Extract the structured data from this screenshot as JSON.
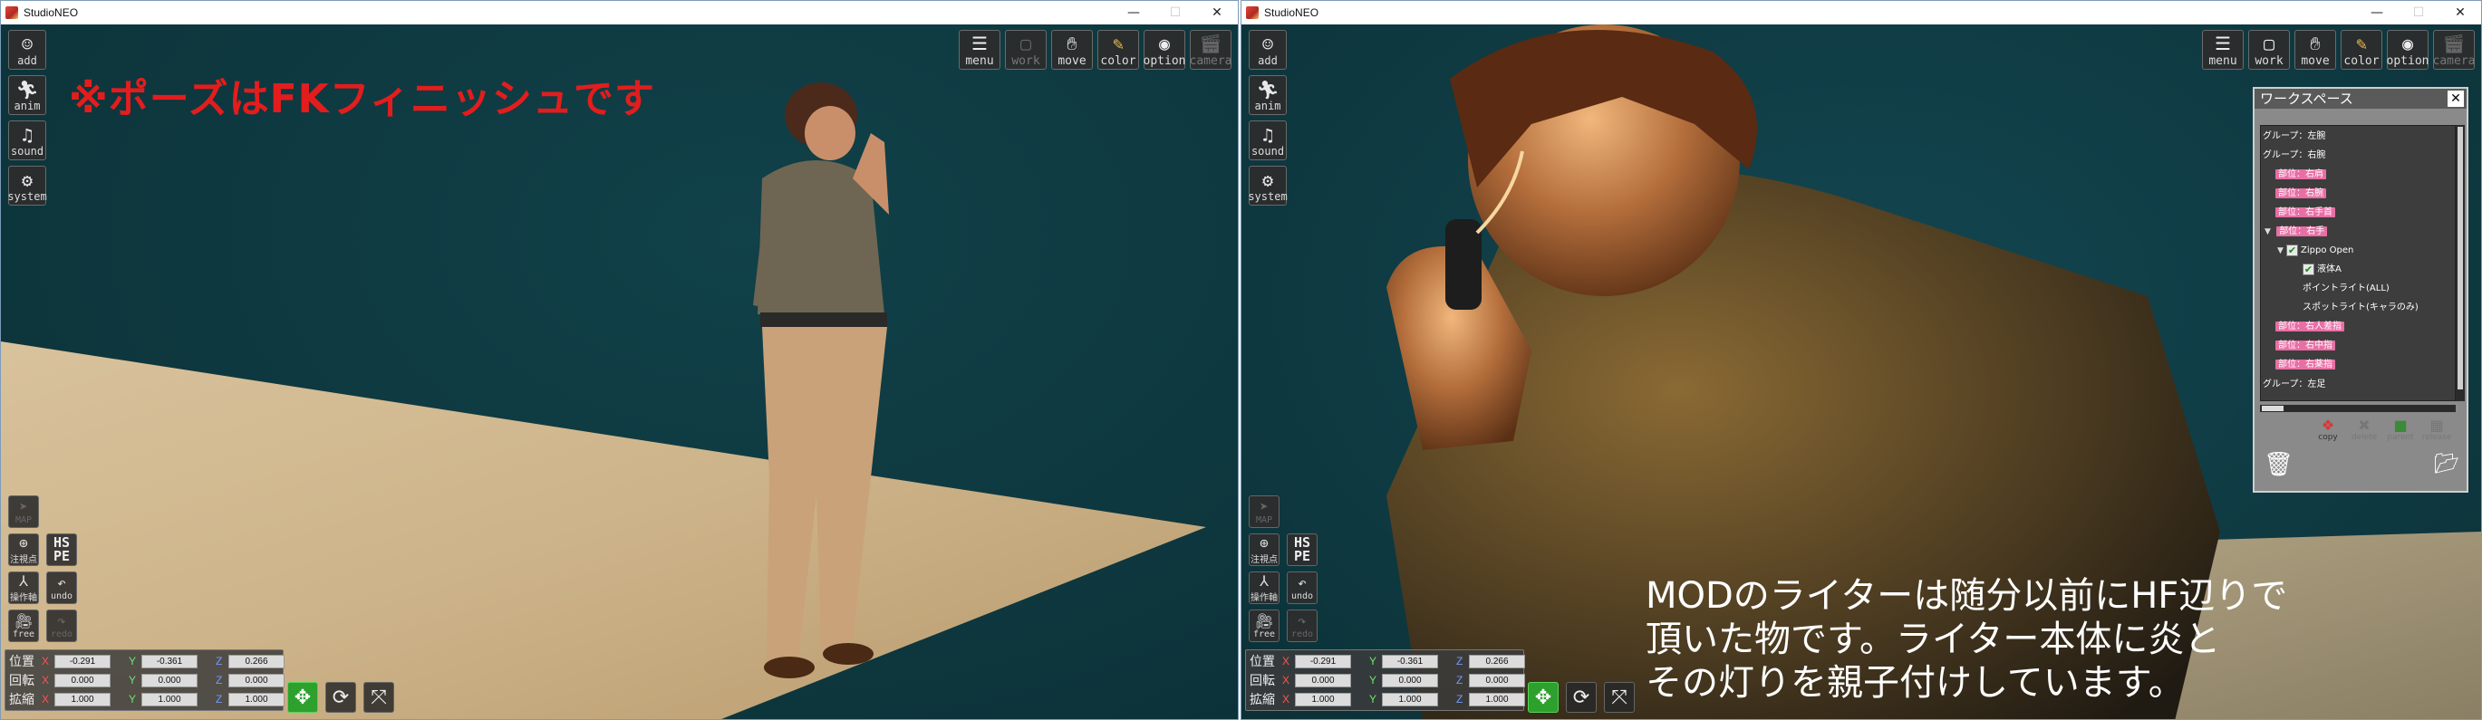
{
  "windows": [
    {
      "title": "StudioNEO",
      "overlay_text": "※ポーズはFKフィニッシュです"
    },
    {
      "title": "StudioNEO",
      "caption": "MODのライターは随分以前にHF辺りで\n頂いた物です。ライター本体に炎と\nその灯りを親子付けしています。"
    }
  ],
  "window_controls": {
    "minimize": "—",
    "maximize": "☐",
    "close": "✕"
  },
  "left_toolbar": [
    {
      "label": "add",
      "icon": "add-character-icon"
    },
    {
      "label": "anim",
      "icon": "running-figure-icon"
    },
    {
      "label": "sound",
      "icon": "music-note-icon"
    },
    {
      "label": "system",
      "icon": "gears-icon"
    }
  ],
  "top_toolbar": [
    {
      "label": "menu",
      "icon": "list-icon",
      "enabled": true
    },
    {
      "label": "work",
      "icon": "window-icon",
      "enabled": false
    },
    {
      "label": "move",
      "icon": "hand-icon",
      "enabled": true
    },
    {
      "label": "color",
      "icon": "palette-icon",
      "enabled": true
    },
    {
      "label": "option",
      "icon": "eye-icon",
      "enabled": true
    },
    {
      "label": "camera",
      "icon": "clapperboard-icon",
      "enabled": false
    }
  ],
  "top_toolbar_right": [
    {
      "label": "menu",
      "icon": "list-icon",
      "enabled": true
    },
    {
      "label": "work",
      "icon": "window-icon",
      "enabled": true
    },
    {
      "label": "move",
      "icon": "hand-icon",
      "enabled": true
    },
    {
      "label": "color",
      "icon": "palette-icon",
      "enabled": true
    },
    {
      "label": "option",
      "icon": "eye-icon",
      "enabled": true
    },
    {
      "label": "camera",
      "icon": "clapperboard-icon",
      "enabled": false
    }
  ],
  "bottom_left_tools": {
    "map": "MAP",
    "center": "注視点",
    "hspe": "HS\nPE",
    "operation": "操作軸",
    "undo": "undo",
    "free": "free",
    "redo": "redo"
  },
  "transform": {
    "rows": [
      {
        "label": "位置",
        "x": "-0.291",
        "y": "-0.361",
        "z": "0.266"
      },
      {
        "label": "回転",
        "x": "0.000",
        "y": "0.000",
        "z": "0.000"
      },
      {
        "label": "拡縮",
        "x": "1.000",
        "y": "1.000",
        "z": "1.000"
      }
    ],
    "axis_labels": {
      "x": "X",
      "y": "Y",
      "z": "Z"
    }
  },
  "workspace": {
    "title": "ワークスペース",
    "close": "✕",
    "items": [
      {
        "indent": 0,
        "text": "グループ：左腕",
        "type": "group"
      },
      {
        "indent": 0,
        "text": "グループ：右腕",
        "type": "group"
      },
      {
        "indent": 1,
        "text": "部位：右肩",
        "type": "tag"
      },
      {
        "indent": 1,
        "text": "部位：右腕",
        "type": "tag"
      },
      {
        "indent": 1,
        "text": "部位：右手首",
        "type": "tag"
      },
      {
        "indent": 1,
        "text": "部位：右手",
        "type": "tag",
        "expanded": true
      },
      {
        "indent": 2,
        "text": "Zippo Open",
        "type": "check",
        "expanded": true
      },
      {
        "indent": 3,
        "text": "液体A",
        "type": "check"
      },
      {
        "indent": 3,
        "text": "ポイントライト(ALL)",
        "type": "plain"
      },
      {
        "indent": 3,
        "text": "スポットライト(キャラのみ)",
        "type": "plain"
      },
      {
        "indent": 1,
        "text": "部位：右人差指",
        "type": "tag"
      },
      {
        "indent": 1,
        "text": "部位：右中指",
        "type": "tag"
      },
      {
        "indent": 1,
        "text": "部位：右薬指",
        "type": "tag"
      },
      {
        "indent": 0,
        "text": "グループ：左足",
        "type": "group"
      }
    ],
    "tools": [
      {
        "label": "copy",
        "enabled": true
      },
      {
        "label": "delete",
        "enabled": false
      },
      {
        "label": "parent",
        "enabled": false
      },
      {
        "label": "release",
        "enabled": false
      }
    ]
  },
  "colors": {
    "background_teal": "#0f3d44",
    "overlay_red": "#e31d1d",
    "tag_pink": "#e86fa5",
    "move_green": "#2ea02e"
  }
}
